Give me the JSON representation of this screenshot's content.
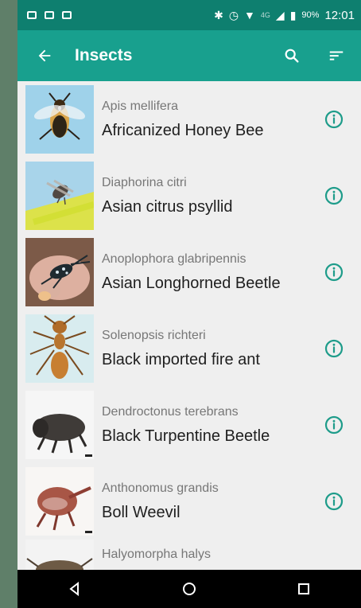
{
  "status_bar": {
    "battery": "90%",
    "time": "12:01",
    "network_hint": "4G"
  },
  "app_bar": {
    "title": "Insects"
  },
  "items": [
    {
      "scientific_name": "Apis mellifera",
      "common_name": "Africanized Honey Bee"
    },
    {
      "scientific_name": "Diaphorina citri",
      "common_name": "Asian citrus psyllid"
    },
    {
      "scientific_name": "Anoplophora glabripennis",
      "common_name": "Asian Longhorned Beetle"
    },
    {
      "scientific_name": "Solenopsis richteri",
      "common_name": "Black imported fire ant"
    },
    {
      "scientific_name": "Dendroctonus terebrans",
      "common_name": "Black Turpentine Beetle"
    },
    {
      "scientific_name": "Anthonomus grandis",
      "common_name": "Boll Weevil"
    },
    {
      "scientific_name": "Halyomorpha halys",
      "common_name": ""
    }
  ],
  "colors": {
    "status_bar_bg": "#0e7f6f",
    "app_bar_bg": "#18a08e",
    "accent": "#1e9c8a",
    "list_bg": "#efefef",
    "nav_bg": "#000000"
  },
  "icons": {
    "back": "arrow-left-icon",
    "search": "search-icon",
    "sort": "sort-icon",
    "info": "info-icon"
  }
}
